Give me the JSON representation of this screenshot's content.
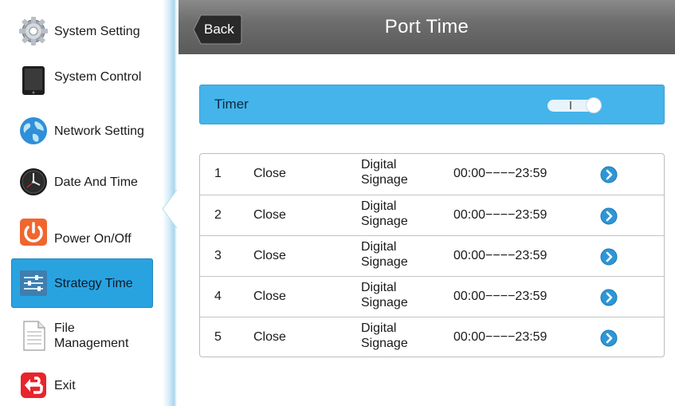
{
  "sidebar": {
    "items": [
      {
        "label": "System Setting",
        "icon": "gear-icon"
      },
      {
        "label": "System Control",
        "icon": "tablet-icon"
      },
      {
        "label": "Network Setting",
        "icon": "globe-icon"
      },
      {
        "label": "Date And Time",
        "icon": "clock-icon"
      },
      {
        "label": "Power On/Off",
        "icon": "power-icon"
      },
      {
        "label": "Strategy Time",
        "icon": "sliders-icon",
        "active": true
      },
      {
        "label": "File\nManagement",
        "icon": "file-icon"
      },
      {
        "label": "Exit",
        "icon": "exit-icon"
      }
    ]
  },
  "header": {
    "back_label": "Back",
    "title": "Port Time"
  },
  "timer": {
    "label": "Timer",
    "enabled": true
  },
  "ports": {
    "rows": [
      {
        "num": "1",
        "state": "Close",
        "source": "Digital\nSignage",
        "time": "00:00−−−−23:59"
      },
      {
        "num": "2",
        "state": "Close",
        "source": "Digital\nSignage",
        "time": "00:00−−−−23:59"
      },
      {
        "num": "3",
        "state": "Close",
        "source": "Digital\nSignage",
        "time": "00:00−−−−23:59"
      },
      {
        "num": "4",
        "state": "Close",
        "source": "Digital\nSignage",
        "time": "00:00−−−−23:59"
      },
      {
        "num": "5",
        "state": "Close",
        "source": "Digital\nSignage",
        "time": "00:00−−−−23:59"
      }
    ]
  },
  "colors": {
    "accent": "#29a3e0",
    "timer_bar": "#44b4eb",
    "header": "#6d6d6d",
    "power": "#f0662e",
    "exit": "#e8242c"
  }
}
